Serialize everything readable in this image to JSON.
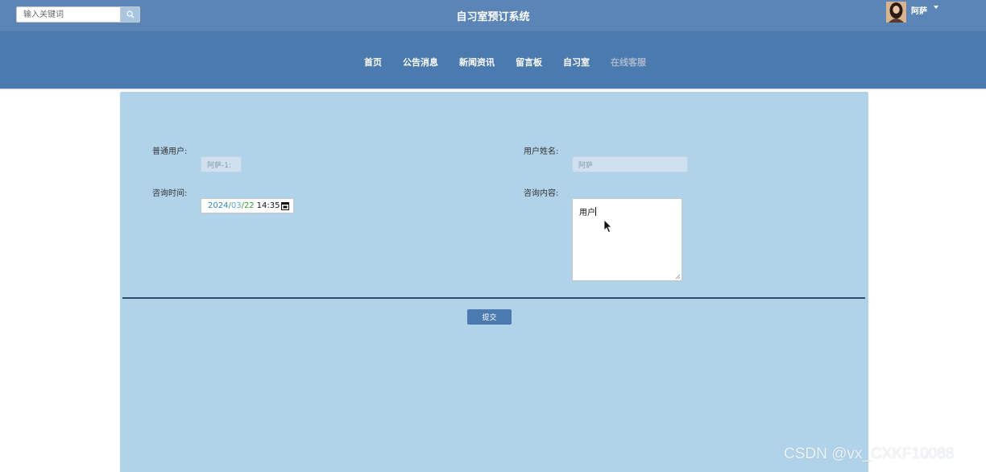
{
  "header": {
    "search_placeholder": "输入关键词",
    "site_title": "自习室预订系统",
    "user_name": "阿萨"
  },
  "nav": {
    "items": [
      "首页",
      "公告消息",
      "新闻资讯",
      "留言板",
      "自习室",
      "在线客服"
    ],
    "active_index": 5
  },
  "form": {
    "user_label": "普通用户:",
    "user_value": "阿萨-1:",
    "name_label": "用户姓名:",
    "name_value": "阿萨",
    "time_label": "咨询时间:",
    "date_year": "2024",
    "date_month": "03",
    "date_day": "22",
    "date_sep": "/",
    "time_value": "14:35",
    "content_label": "咨询内容:",
    "content_value": "用户",
    "submit_label": "提交"
  },
  "watermark": "CSDN @vx_CXKF10088",
  "colors": {
    "topbar": "#5b84b7",
    "navbar": "#4b7aaf",
    "content_bg": "#b0d3ea",
    "divider": "#2d4a6e"
  }
}
